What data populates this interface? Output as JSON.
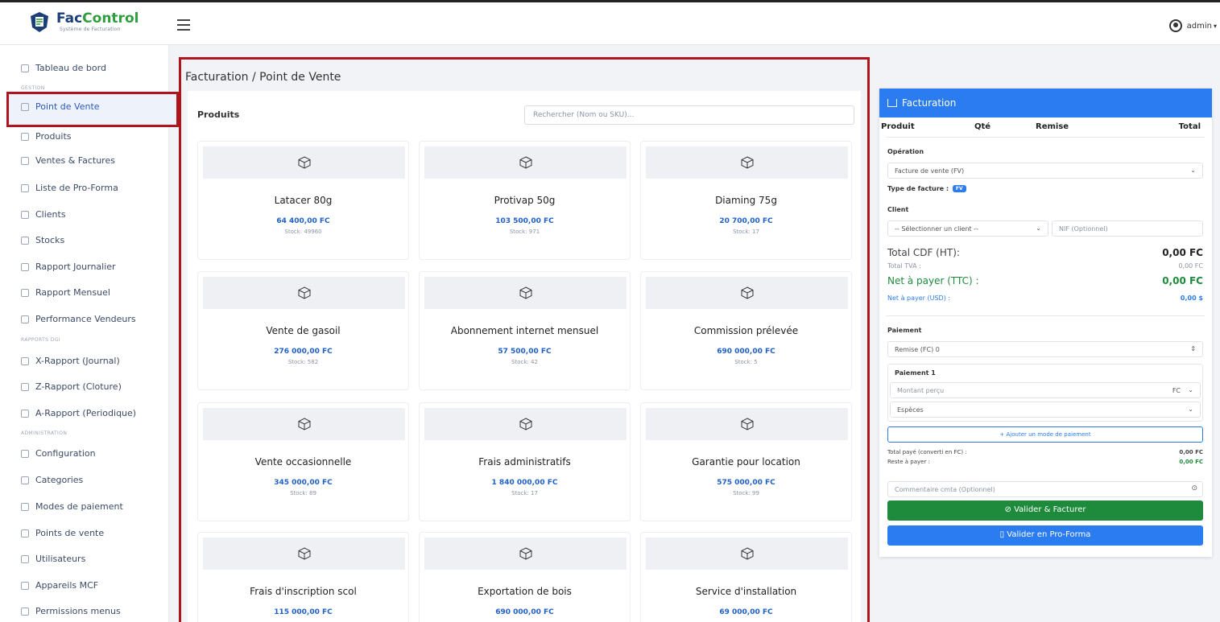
{
  "header": {
    "logo_name_a": "Fac",
    "logo_name_b": "Control",
    "logo_sub": "Système de Facturation",
    "user": "admin"
  },
  "sidebar": {
    "items": [
      {
        "label": "Tableau de bord",
        "icon": "dashboard-icon"
      },
      {
        "label": "Point de Vente",
        "icon": "cart-icon"
      },
      {
        "label": "Produits",
        "icon": "box-icon"
      },
      {
        "label": "Ventes & Factures",
        "icon": "invoice-icon"
      },
      {
        "label": "Liste de Pro-Forma",
        "icon": "file-icon"
      },
      {
        "label": "Clients",
        "icon": "users-icon"
      },
      {
        "label": "Stocks",
        "icon": "stack-icon"
      },
      {
        "label": "Rapport Journalier",
        "icon": "chart-icon"
      },
      {
        "label": "Rapport Mensuel",
        "icon": "calendar-icon"
      },
      {
        "label": "Performance Vendeurs",
        "icon": "doc-icon"
      },
      {
        "label": "X-Rapport (Journal)",
        "icon": "file-icon"
      },
      {
        "label": "Z-Rapport (Cloture)",
        "icon": "file-icon"
      },
      {
        "label": "A-Rapport (Periodique)",
        "icon": "file-icon"
      },
      {
        "label": "Configuration",
        "icon": "sliders-icon"
      },
      {
        "label": "Categories",
        "icon": "tag-icon"
      },
      {
        "label": "Modes de paiement",
        "icon": "card-icon"
      },
      {
        "label": "Points de vente",
        "icon": "store-icon"
      },
      {
        "label": "Utilisateurs",
        "icon": "users-icon"
      },
      {
        "label": "Appareils MCF",
        "icon": "device-icon"
      },
      {
        "label": "Permissions menus",
        "icon": "shield-icon"
      }
    ],
    "sections": [
      "GESTION",
      "RAPPORTS DGI",
      "ADMINISTRATION"
    ]
  },
  "main": {
    "title": "Facturation / Point de Vente",
    "products_label": "Produits",
    "search_placeholder": "Rechercher (Nom ou SKU)...",
    "products": [
      {
        "name": "Latacer 80g",
        "price": "64 400,00 FC",
        "stock": "Stock: 49960"
      },
      {
        "name": "Protivap 50g",
        "price": "103 500,00 FC",
        "stock": "Stock: 971"
      },
      {
        "name": "Diaming 75g",
        "price": "20 700,00 FC",
        "stock": "Stock: 17"
      },
      {
        "name": "Vente de gasoil",
        "price": "276 000,00 FC",
        "stock": "Stock: 582"
      },
      {
        "name": "Abonnement internet mensuel",
        "price": "57 500,00 FC",
        "stock": "Stock: 42"
      },
      {
        "name": "Commission prélevée",
        "price": "690 000,00 FC",
        "stock": "Stock: 5"
      },
      {
        "name": "Vente occasionnelle",
        "price": "345 000,00 FC",
        "stock": "Stock: 89"
      },
      {
        "name": "Frais administratifs",
        "price": "1 840 000,00 FC",
        "stock": "Stock: 17"
      },
      {
        "name": "Garantie pour location",
        "price": "575 000,00 FC",
        "stock": "Stock: 99"
      },
      {
        "name": "Frais d'inscription scol",
        "price": "115 000,00 FC",
        "stock": ""
      },
      {
        "name": "Exportation de bois",
        "price": "690 000,00 FC",
        "stock": ""
      },
      {
        "name": "Service d'installation",
        "price": "69 000,00 FC",
        "stock": ""
      }
    ]
  },
  "facturation": {
    "title": "Facturation",
    "cols": {
      "produit": "Produit",
      "qte": "Qté",
      "remise": "Remise",
      "total": "Total"
    },
    "operation_label": "Opération",
    "operation_value": "Facture de vente (FV)",
    "type_label": "Type de facture :",
    "type_badge": "FV",
    "client_label": "Client",
    "client_placeholder": "-- Sélectionner un client --",
    "nif_placeholder": "NIF (Optionnel)",
    "total_ht_label": "Total CDF (HT):",
    "total_ht": "0,00 FC",
    "tva_label": "Total TVA :",
    "tva": "0,00 FC",
    "net_label": "Net à payer (TTC) :",
    "net": "0,00 FC",
    "net_usd_label": "Net à payer (USD) :",
    "net_usd": "0,00 $",
    "paiement_label": "Paiement",
    "remise_label": "Remise (FC)",
    "remise_value": "0",
    "paiement1_label": "Paiement 1",
    "montant_placeholder": "Montant perçu",
    "currency": "FC",
    "mode": "Espèces",
    "add_mode": "+ Ajouter un mode de paiement",
    "total_paye_label": "Total payé (converti en FC) :",
    "total_paye": "0,00 FC",
    "reste_label": "Reste à payer :",
    "reste": "0,00 FC",
    "comment_placeholder": "Commentaire cmta (Optionnel)",
    "btn_valider": "Valider & Facturer",
    "btn_proforma": "Valider en Pro-Forma",
    "colors": {
      "primary": "#2b7cf0",
      "success": "#1e8a3c",
      "highlight": "#b0141c"
    }
  }
}
